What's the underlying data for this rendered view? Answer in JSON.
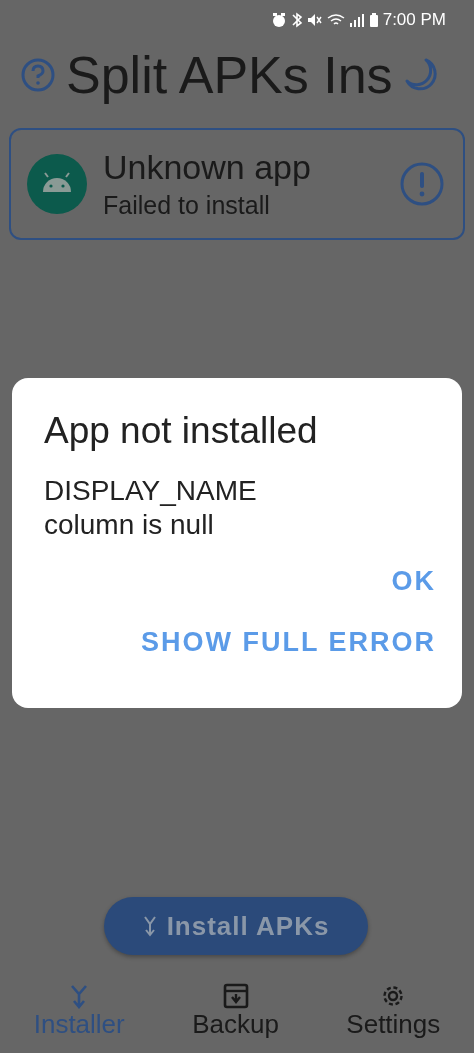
{
  "status_bar": {
    "time": "7:00 PM"
  },
  "app_bar": {
    "title": "Split APKs Ins"
  },
  "apps": [
    {
      "name": "Unknown app",
      "status": "Failed to install"
    }
  ],
  "install_button": {
    "label": "Install APKs"
  },
  "bottom_nav": [
    {
      "label": "Installer",
      "selected": true
    },
    {
      "label": "Backup",
      "selected": false
    },
    {
      "label": "Settings",
      "selected": false
    }
  ],
  "dialog": {
    "title": "App not installed",
    "message": "DISPLAY_NAME column is null",
    "buttons": [
      "OK",
      "SHOW FULL ERROR"
    ]
  }
}
